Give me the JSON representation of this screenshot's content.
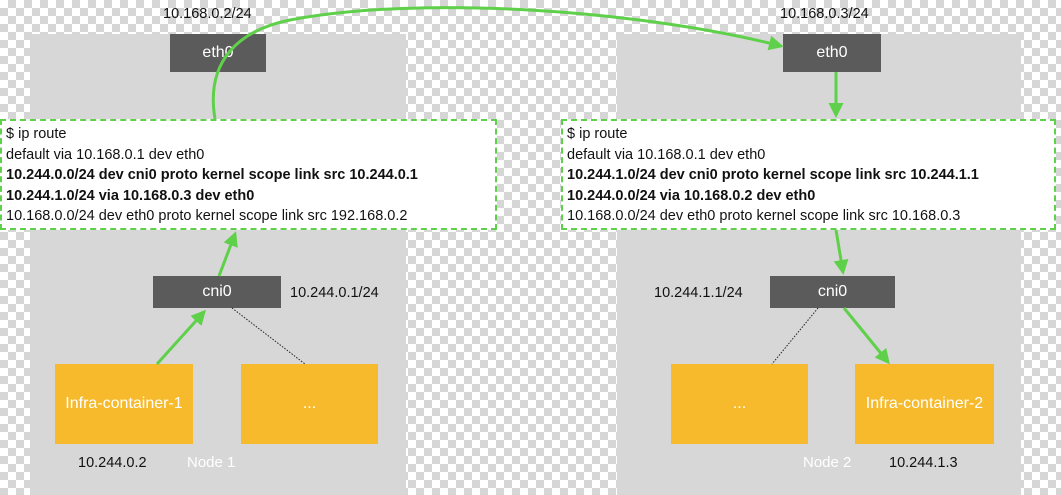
{
  "colors": {
    "panel": "#d7d7d7",
    "interface": "#5b5b5b",
    "container": "#f6ba2c",
    "arrow": "#5fd04a",
    "route_border": "#5fd04a"
  },
  "node1": {
    "name": "Node 1",
    "host_ip": "10.168.0.2/24",
    "eth0": "eth0",
    "cni0": "cni0",
    "cni0_ip": "10.244.0.1/24",
    "route_lines": [
      {
        "text": "$ ip route",
        "bold": false
      },
      {
        "text": "default via 10.168.0.1 dev eth0",
        "bold": false
      },
      {
        "text": "10.244.0.0/24 dev cni0 proto kernel scope link src 10.244.0.1",
        "bold": true
      },
      {
        "text": "10.244.1.0/24 via 10.168.0.3 dev eth0",
        "bold": true
      },
      {
        "text": "10.168.0.0/24 dev eth0 proto kernel scope link src 192.168.0.2",
        "bold": false
      }
    ],
    "container_a": "Infra-container-1",
    "container_a_ip": "10.244.0.2",
    "container_b": "..."
  },
  "node2": {
    "name": "Node 2",
    "host_ip": "10.168.0.3/24",
    "eth0": "eth0",
    "cni0": "cni0",
    "cni0_ip": "10.244.1.1/24",
    "route_lines": [
      {
        "text": "$ ip route",
        "bold": false
      },
      {
        "text": "default via 10.168.0.1 dev eth0",
        "bold": false
      },
      {
        "text": "10.244.1.0/24 dev cni0 proto kernel scope link src 10.244.1.1",
        "bold": true
      },
      {
        "text": "10.244.0.0/24 via 10.168.0.2 dev eth0",
        "bold": true
      },
      {
        "text": "10.168.0.0/24 dev eth0 proto kernel scope link src 10.168.0.3",
        "bold": false
      }
    ],
    "container_a": "...",
    "container_b": "Infra-container-2",
    "container_b_ip": "10.244.1.3"
  }
}
